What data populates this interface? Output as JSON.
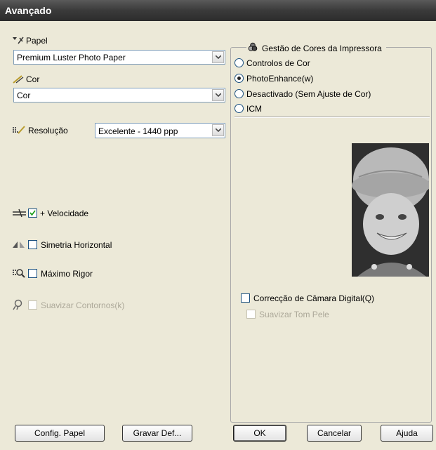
{
  "window": {
    "title": "Avançado"
  },
  "left": {
    "paper": {
      "label": "Papel",
      "value": "Premium Luster Photo Paper"
    },
    "color": {
      "label": "Cor",
      "value": "Cor"
    },
    "resolution": {
      "label": "Resolução",
      "value": "Excelente - 1440 ppp"
    },
    "options": {
      "speed": {
        "label": "+ Velocidade",
        "checked": true,
        "enabled": true
      },
      "mirror": {
        "label": "Simetria Horizontal",
        "checked": false,
        "enabled": true
      },
      "finest": {
        "label": "Máximo Rigor",
        "checked": false,
        "enabled": true
      },
      "smooth": {
        "label": "Suavizar Contornos(k)",
        "checked": false,
        "enabled": false
      }
    }
  },
  "color_management": {
    "title": "Gestão de Cores da Impressora",
    "options": [
      "Controlos de Cor",
      "PhotoEnhance(w)",
      "Desactivado (Sem Ajuste de Cor)",
      "ICM"
    ],
    "selected": "PhotoEnhance(w)",
    "digital_camera": {
      "label": "Correcção de Câmara Digital(Q)",
      "checked": false
    },
    "skin_tone": {
      "label": "Suavizar Tom Pele",
      "checked": false,
      "enabled": false
    }
  },
  "buttons": {
    "paper_config": "Config. Papel",
    "save_settings": "Gravar Def...",
    "ok": "OK",
    "cancel": "Cancelar",
    "help": "Ajuda"
  },
  "colors": {
    "titlebar": "#3a3a3a",
    "dialog_bg": "#ece9d8",
    "disabled_text": "#aca899"
  }
}
